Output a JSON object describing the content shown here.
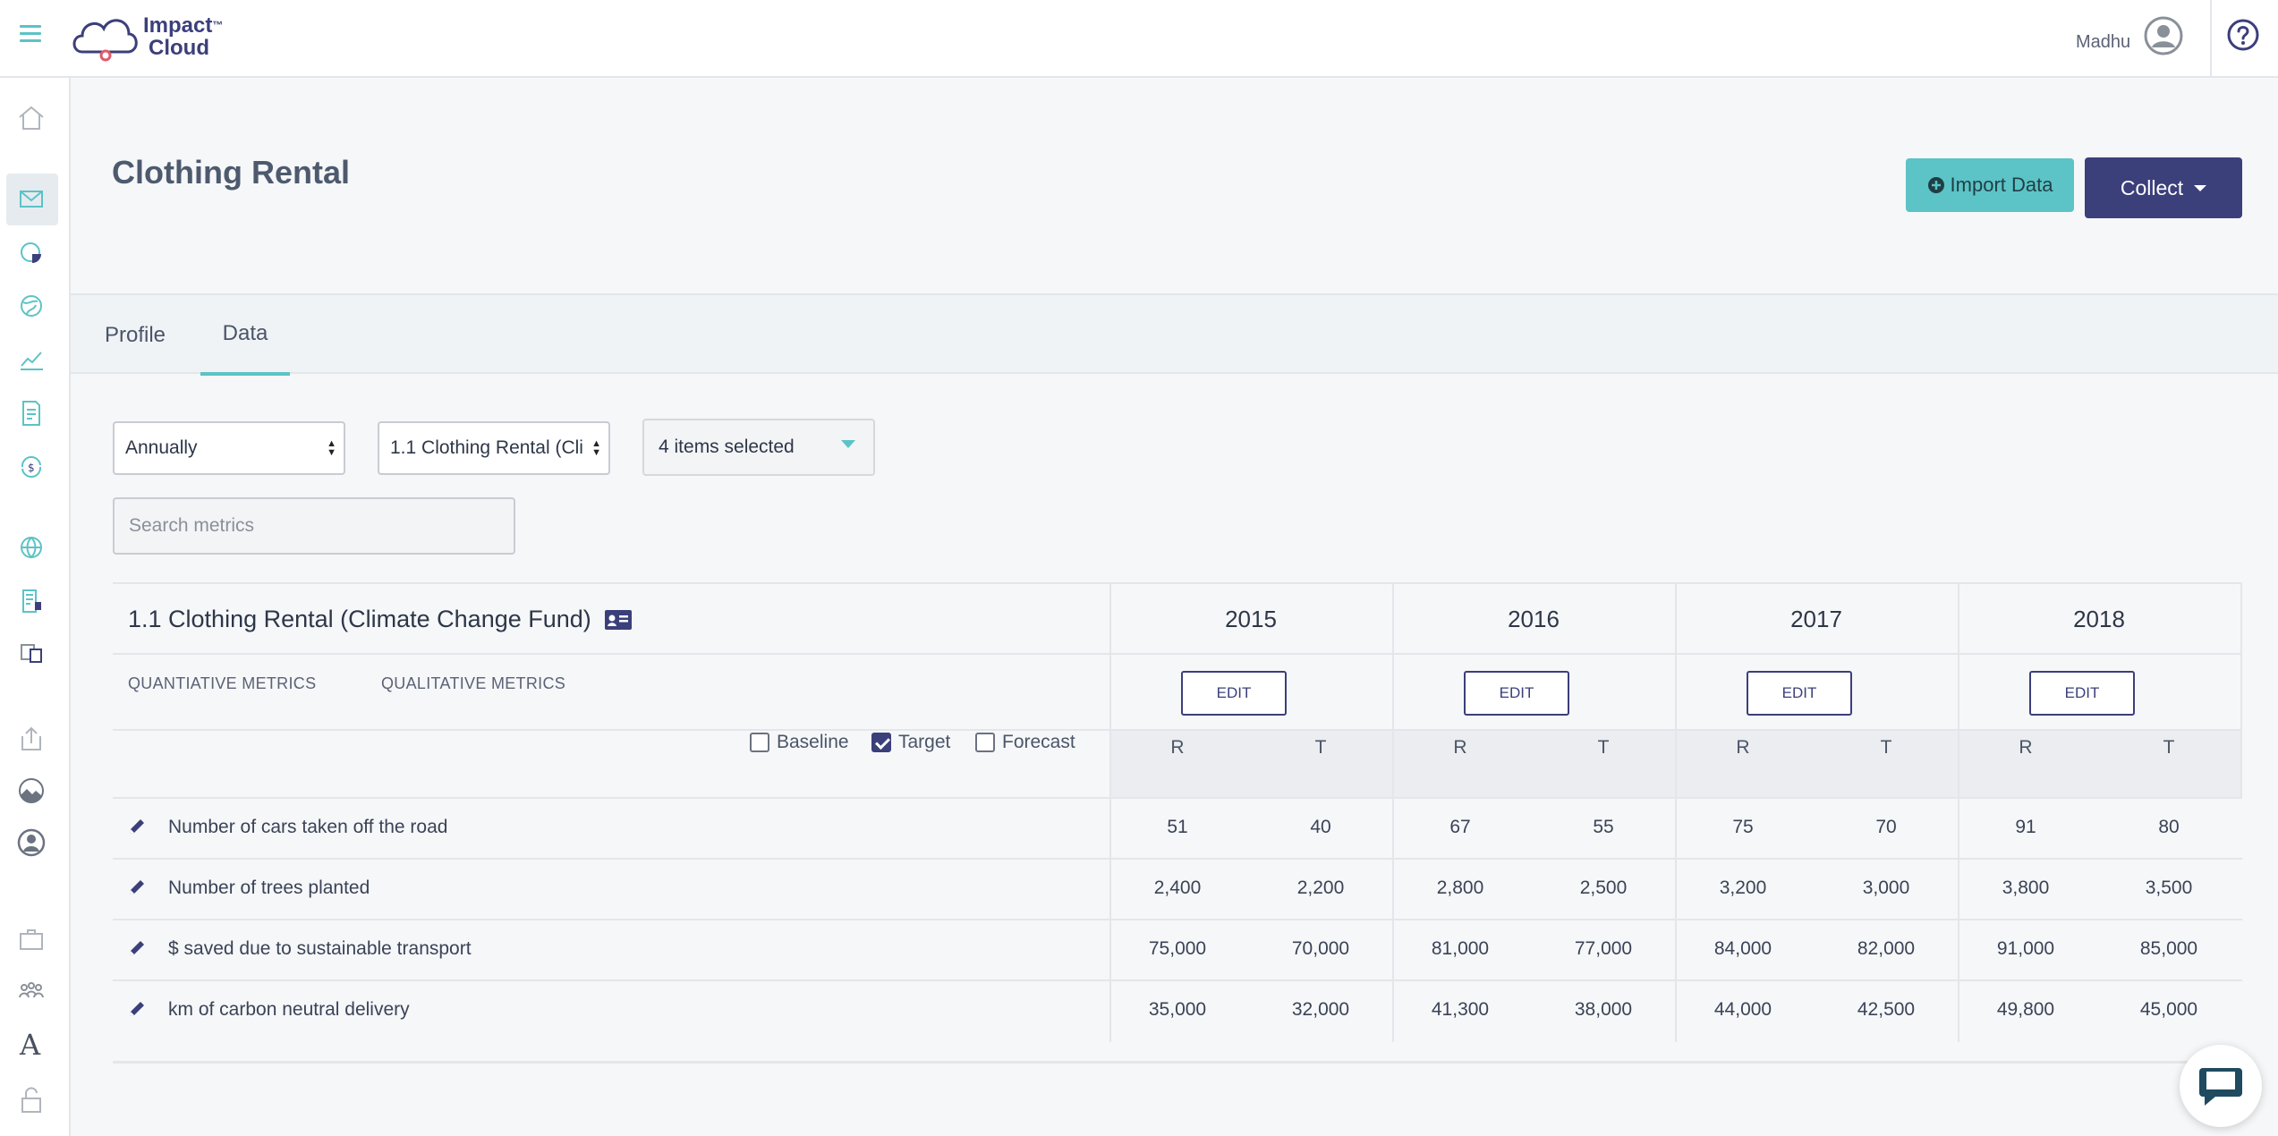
{
  "app": {
    "logo_text_line1": "Impact",
    "logo_text_line2": "Cloud",
    "logo_trademark": "™",
    "brand_color": "#3b3f7a",
    "accent_color": "#5cc3c6"
  },
  "header": {
    "user_name": "Madhu"
  },
  "page": {
    "title": "Clothing Rental",
    "import_label": "Import Data",
    "collect_label": "Collect"
  },
  "tabs": [
    {
      "label": "Profile",
      "active": false
    },
    {
      "label": "Data",
      "active": true
    }
  ],
  "filters": {
    "period": "Annually",
    "fund": "1.1 Clothing Rental (Climate Change Fund)",
    "items_selected": "4 items selected",
    "search_placeholder": "Search metrics"
  },
  "table": {
    "fund_title": "1.1 Clothing Rental (Climate Change Fund)",
    "metric_tabs": [
      "QUANTIATIVE METRICS",
      "QUALITATIVE METRICS"
    ],
    "years": [
      "2015",
      "2016",
      "2017",
      "2018"
    ],
    "edit_label": "EDIT",
    "sub_headers": [
      "R",
      "T"
    ],
    "checkboxes": [
      {
        "label": "Baseline",
        "checked": false
      },
      {
        "label": "Target",
        "checked": true
      },
      {
        "label": "Forecast",
        "checked": false
      }
    ],
    "rows": [
      {
        "label": "Number of cars taken off the road",
        "values": [
          "51",
          "40",
          "67",
          "55",
          "75",
          "70",
          "91",
          "80"
        ]
      },
      {
        "label": "Number of trees planted",
        "values": [
          "2,400",
          "2,200",
          "2,800",
          "2,500",
          "3,200",
          "3,000",
          "3,800",
          "3,500"
        ]
      },
      {
        "label": "$ saved due to sustainable transport",
        "values": [
          "75,000",
          "70,000",
          "81,000",
          "77,000",
          "84,000",
          "82,000",
          "91,000",
          "85,000"
        ]
      },
      {
        "label": "km of carbon neutral delivery",
        "values": [
          "35,000",
          "32,000",
          "41,300",
          "38,000",
          "44,000",
          "42,500",
          "49,800",
          "45,000"
        ]
      }
    ]
  }
}
